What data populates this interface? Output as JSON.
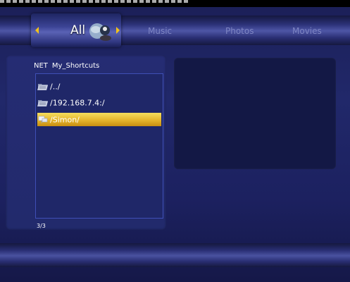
{
  "menu": {
    "tabs": [
      {
        "label": "All",
        "selected": true
      },
      {
        "label": "Music",
        "selected": false
      },
      {
        "label": "Photos",
        "selected": false
      },
      {
        "label": "Movies",
        "selected": false
      }
    ],
    "selected_icon": "globe-avatar-icon"
  },
  "browser": {
    "path": [
      "NET",
      "My_Shortcuts"
    ],
    "items": [
      {
        "label": "/../",
        "icon": "folder-icon",
        "selected": false
      },
      {
        "label": "/192.168.7.4:/",
        "icon": "folder-icon",
        "selected": false
      },
      {
        "label": "/Simon/",
        "icon": "network-share-icon",
        "selected": true
      }
    ],
    "page": "3/3"
  },
  "colors": {
    "background": "#21286a",
    "highlight": "#e5b52c",
    "tab_inactive": "#7e85c3",
    "preview_bg": "#131845"
  }
}
